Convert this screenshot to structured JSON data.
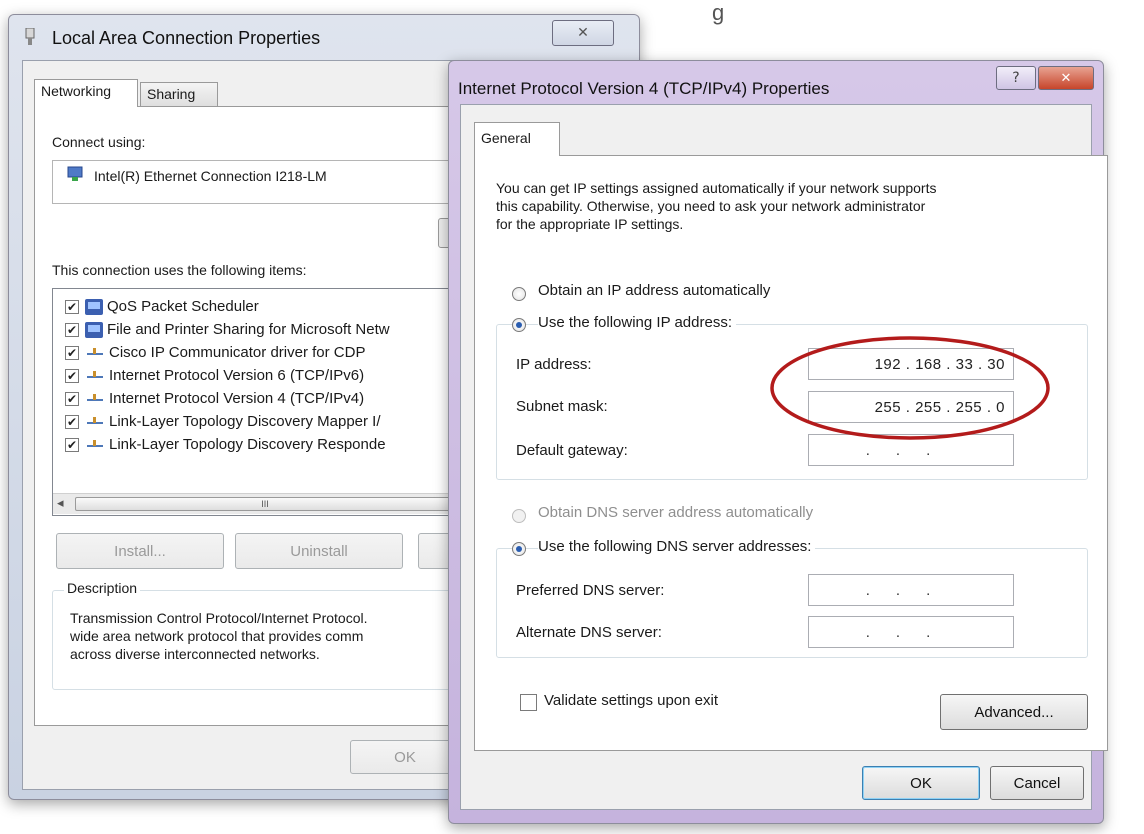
{
  "back_window": {
    "title": "Local Area Connection Properties",
    "close_glyph": "✕",
    "tabs": [
      "Networking",
      "Sharing"
    ],
    "connect_using_label": "Connect using:",
    "adapter_name": "Intel(R) Ethernet Connection I218-LM",
    "items_label": "This connection uses the following items:",
    "items": [
      {
        "label": "QoS Packet Scheduler",
        "checked": "✔",
        "icon": "network-client-icon"
      },
      {
        "label": "File and Printer Sharing for Microsoft Netw",
        "checked": "✔",
        "icon": "network-client-icon"
      },
      {
        "label": "Cisco IP Communicator driver for CDP",
        "checked": "✔",
        "icon": "protocol-icon"
      },
      {
        "label": "Internet Protocol Version 6 (TCP/IPv6)",
        "checked": "✔",
        "icon": "protocol-icon"
      },
      {
        "label": "Internet Protocol Version 4 (TCP/IPv4)",
        "checked": "✔",
        "icon": "protocol-icon"
      },
      {
        "label": "Link-Layer Topology Discovery Mapper I/",
        "checked": "✔",
        "icon": "protocol-icon"
      },
      {
        "label": "Link-Layer Topology Discovery Responde",
        "checked": "✔",
        "icon": "protocol-icon"
      }
    ],
    "scroll_left": "◂",
    "scroll_grip": "III",
    "install_label": "Install...",
    "uninstall_label": "Uninstall",
    "description_label": "Description",
    "description_lines": [
      "Transmission Control Protocol/Internet Protocol.",
      "wide area network protocol that provides comm",
      "across diverse interconnected networks."
    ],
    "ok_label": "OK"
  },
  "dialog": {
    "title": "Internet Protocol Version 4 (TCP/IPv4) Properties",
    "help_glyph": "?",
    "close_glyph": "✕",
    "tab_general": "General",
    "intro_lines": [
      "You can get IP settings assigned automatically if your network supports",
      "this capability. Otherwise, you need to ask your network administrator",
      "for the appropriate IP settings."
    ],
    "radio_auto_ip": "Obtain an IP address automatically",
    "radio_manual_ip": "Use the following IP address:",
    "ip_address_label": "IP address:",
    "ip_address_value": "192 . 168 .  33  .  30",
    "subnet_label": "Subnet mask:",
    "subnet_value": "255 . 255 . 255 .  0",
    "gateway_label": "Default gateway:",
    "empty_ip": "...",
    "radio_auto_dns": "Obtain DNS server address automatically",
    "radio_manual_dns": "Use the following DNS server addresses:",
    "preferred_dns_label": "Preferred DNS server:",
    "alternate_dns_label": "Alternate DNS server:",
    "validate_label": "Validate settings upon exit",
    "advanced_label": "Advanced...",
    "ok_label": "OK",
    "cancel_label": "Cancel",
    "highlight_color": "#b31b1b"
  }
}
